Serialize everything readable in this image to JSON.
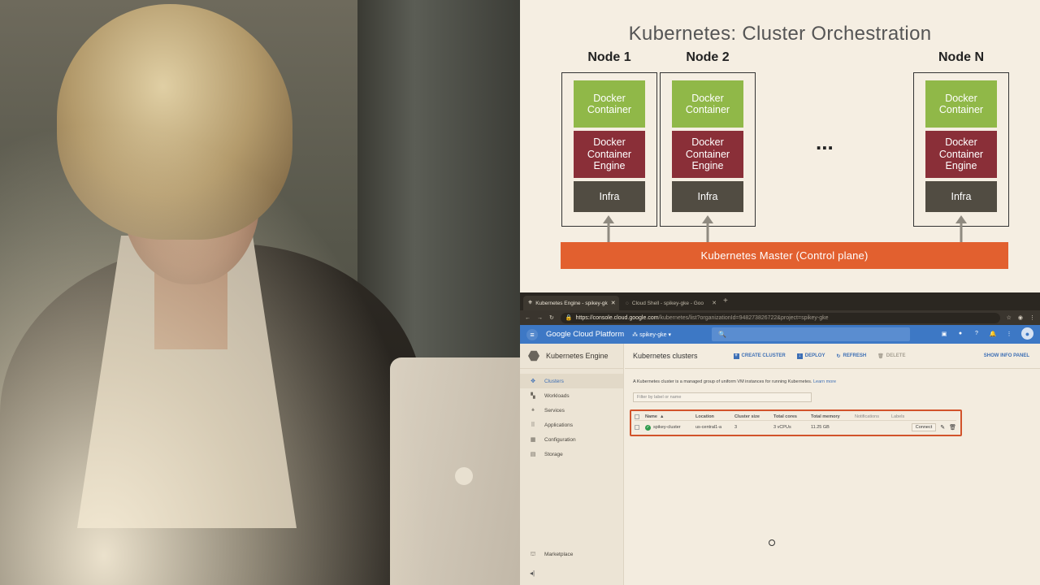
{
  "slide": {
    "title": "Kubernetes: Cluster Orchestration",
    "nodes": [
      {
        "label": "Node 1",
        "container": "Docker Container",
        "engine": "Docker Container Engine",
        "infra": "Infra"
      },
      {
        "label": "Node 2",
        "container": "Docker Container",
        "engine": "Docker Container Engine",
        "infra": "Infra"
      },
      {
        "label": "Node N",
        "container": "Docker Container",
        "engine": "Docker Container Engine",
        "infra": "Infra"
      }
    ],
    "ellipsis": "...",
    "master": "Kubernetes Master (Control plane)",
    "colors": {
      "container": "#90b848",
      "engine": "#8a2f38",
      "infra": "#514c42",
      "master": "#e2602f"
    }
  },
  "browser": {
    "tabs": [
      {
        "title": "Kubernetes Engine - spikey-gk",
        "active": true
      },
      {
        "title": "Cloud Shell - spikey-gke - Goo",
        "active": false
      }
    ],
    "url_host": "https://console.cloud.google.com",
    "url_path": "/kubernetes/list?organizationId=948273826722&project=spikey-gke"
  },
  "gcp": {
    "product": "Google Cloud Platform",
    "project": "spikey-gke",
    "accent": "#3d78c5"
  },
  "sidebar": {
    "title": "Kubernetes Engine",
    "items": [
      {
        "label": "Clusters",
        "icon": "clusters-icon",
        "active": true
      },
      {
        "label": "Workloads",
        "icon": "workloads-icon",
        "active": false
      },
      {
        "label": "Services",
        "icon": "services-icon",
        "active": false
      },
      {
        "label": "Applications",
        "icon": "applications-icon",
        "active": false
      },
      {
        "label": "Configuration",
        "icon": "configuration-icon",
        "active": false
      },
      {
        "label": "Storage",
        "icon": "storage-icon",
        "active": false
      }
    ],
    "marketplace": "Marketplace"
  },
  "main": {
    "title": "Kubernetes clusters",
    "actions": {
      "create": "CREATE CLUSTER",
      "deploy": "DEPLOY",
      "refresh": "REFRESH",
      "delete": "DELETE"
    },
    "info_panel": "SHOW INFO PANEL",
    "description": "A Kubernetes cluster is a managed group of uniform VM instances for running Kubernetes.",
    "learn_more": "Learn more",
    "filter_placeholder": "Filter by label or name",
    "columns": [
      "Name",
      "Location",
      "Cluster size",
      "Total cores",
      "Total memory",
      "Notifications",
      "Labels"
    ],
    "rows": [
      {
        "name": "spikey-cluster",
        "location": "us-central1-a",
        "size": "3",
        "cores": "3 vCPUs",
        "memory": "11.25 GB",
        "connect": "Connect"
      }
    ]
  }
}
